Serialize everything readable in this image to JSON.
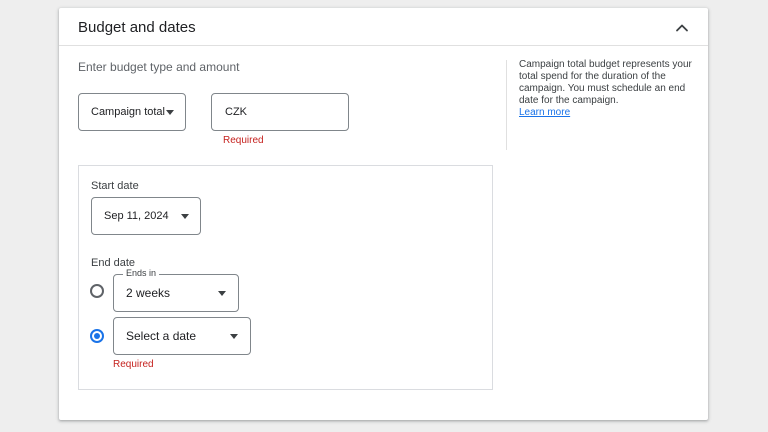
{
  "section": {
    "title": "Budget and dates",
    "budget_label": "Enter budget type and amount"
  },
  "budget": {
    "type_selected": "Campaign total",
    "currency_prefix": "CZK",
    "amount_value": "",
    "error": "Required"
  },
  "help": {
    "text": "Campaign total budget represents your total spend for the duration of the campaign. You must schedule an end date for the campaign.",
    "link": "Learn more"
  },
  "dates": {
    "start_label": "Start date",
    "start_value": "Sep 11, 2024",
    "end_label": "End date",
    "ends_in_label": "Ends in",
    "ends_in_value": "2 weeks",
    "select_date_value": "Select a date",
    "select_date_error": "Required",
    "ends_in_checked": false,
    "select_date_checked": true
  },
  "icons": {
    "collapse": "chevron-up-icon",
    "dropdown": "caret-down-icon"
  },
  "colors": {
    "accent": "#1a73e8",
    "error": "#c5221f",
    "border": "#80868b"
  }
}
